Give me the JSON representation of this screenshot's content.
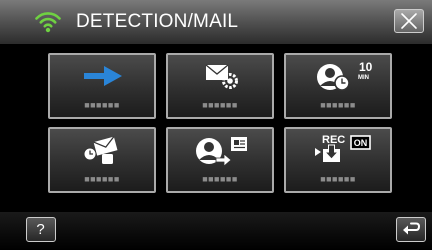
{
  "header": {
    "title": "DETECTION/MAIL",
    "wifi_icon": "wifi-signal-icon",
    "accent_color": "#6fd142"
  },
  "tiles": [
    {
      "name": "detection-arrow-tile",
      "icon": "blue-arrow-icon",
      "label": "■■■■■■"
    },
    {
      "name": "mail-setting-tile",
      "icon": "mail-gear-icon",
      "label": "■■■■■■"
    },
    {
      "name": "face-timer-tile",
      "icon": "face-clock-icon",
      "label": "■■■■■■",
      "timer_value": "10",
      "timer_unit": "MIN"
    },
    {
      "name": "mail-sender-tile",
      "icon": "envelope-clock-icon",
      "label": "■■■■■■"
    },
    {
      "name": "face-mail-tile",
      "icon": "face-send-icon",
      "label": "■■■■■■"
    },
    {
      "name": "rec-auto-tile",
      "icon": "rec-on-icon",
      "label": "■■■■■■",
      "rec_text": "REC",
      "on_text": "ON"
    }
  ],
  "footer": {
    "help_label": "?",
    "help_icon": "question-icon",
    "back_icon": "return-arrow-icon"
  }
}
